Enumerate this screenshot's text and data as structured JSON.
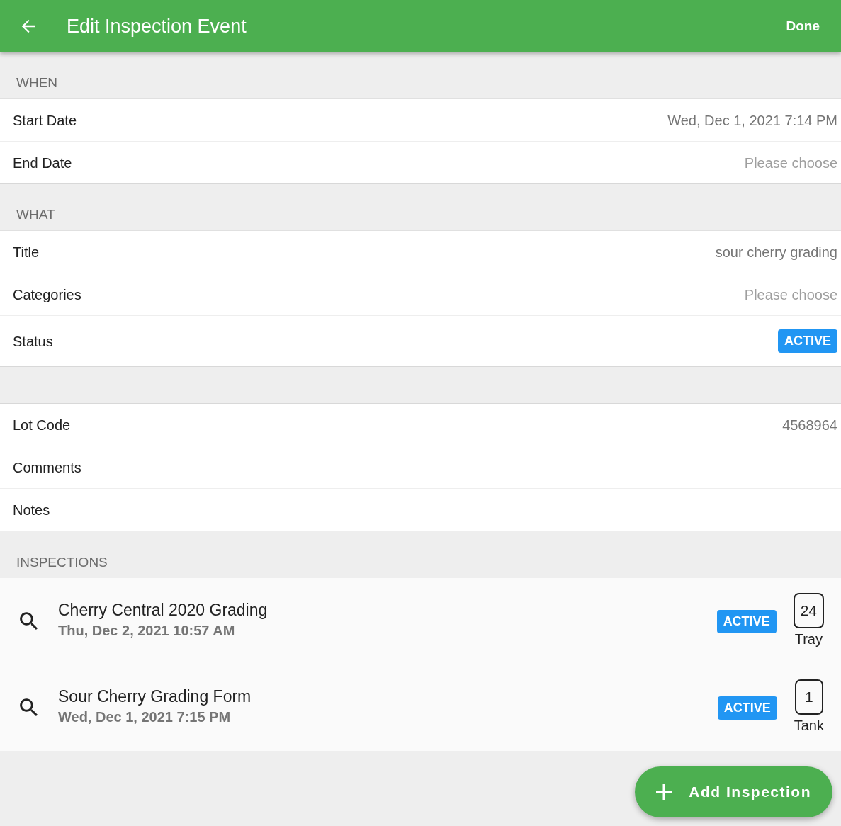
{
  "app_bar": {
    "title": "Edit Inspection Event",
    "action": "Done"
  },
  "sections": [
    {
      "header": "WHEN",
      "fields": [
        {
          "label": "Start Date",
          "kind": "value",
          "value": "Wed, Dec 1, 2021 7:14 PM"
        },
        {
          "label": "End Date",
          "kind": "placeholder",
          "value": "Please choose"
        }
      ]
    },
    {
      "header": "WHAT",
      "fields": [
        {
          "label": "Title",
          "kind": "value",
          "value": "sour cherry grading"
        },
        {
          "label": "Categories",
          "kind": "placeholder",
          "value": "Please choose"
        },
        {
          "label": "Status",
          "kind": "badge",
          "value": "ACTIVE"
        }
      ]
    },
    {
      "fields": [
        {
          "label": "Lot Code",
          "kind": "value",
          "value": "4568964"
        },
        {
          "label": "Comments",
          "kind": "empty"
        },
        {
          "label": "Notes",
          "kind": "empty"
        }
      ]
    }
  ],
  "inspections": {
    "header": "INSPECTIONS",
    "items": [
      {
        "name": "Cherry Central 2020 Grading",
        "date": "Thu, Dec 2, 2021 10:57 AM",
        "status": "ACTIVE",
        "count": "24",
        "unit": "Tray"
      },
      {
        "name": "Sour Cherry Grading Form",
        "date": "Wed, Dec 1, 2021 7:15 PM",
        "status": "ACTIVE",
        "count": "1",
        "unit": "Tank"
      }
    ]
  },
  "fab": {
    "label": "Add Inspection"
  }
}
